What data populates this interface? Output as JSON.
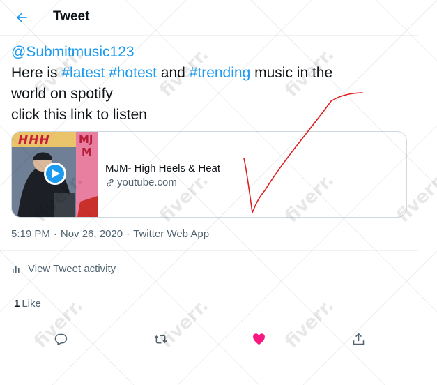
{
  "header": {
    "title": "Tweet",
    "back_icon": "arrow-left-icon"
  },
  "tweet": {
    "mention": "@Submitmusic123",
    "text_part1": "Here is ",
    "hashtag1": "#latest",
    "text_space1": " ",
    "hashtag2": "#hotest",
    "text_part2": " and ",
    "hashtag3": "#trending",
    "text_part3": " music in the",
    "line3": "world on spotify",
    "line4": "click this link to listen"
  },
  "card": {
    "title": "MJM- High Heels & Heat",
    "domain": "youtube.com",
    "thumbnail_text_left": "HHH",
    "thumbnail_text_right": "MJ",
    "thumbnail_text_right2": "M"
  },
  "meta": {
    "time": "5:19 PM",
    "date": "Nov 26, 2020",
    "app": "Twitter Web App"
  },
  "activity": {
    "label": "View Tweet activity"
  },
  "likes": {
    "count": "1",
    "label": "Like"
  },
  "watermark": {
    "text": "fiverr."
  },
  "colors": {
    "accent": "#1d9bf0",
    "like": "#f91880",
    "annotation": "#e02020"
  }
}
